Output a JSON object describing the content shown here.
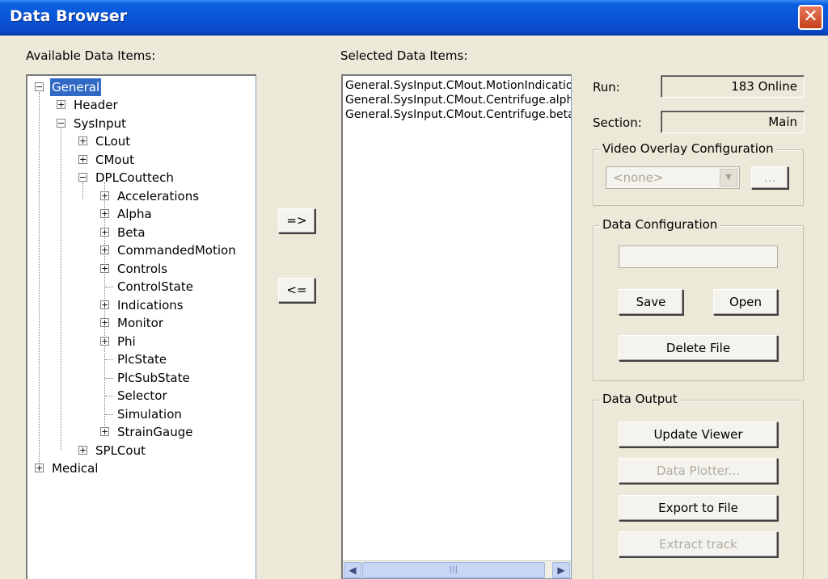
{
  "window": {
    "title": "Data Browser",
    "close_glyph": "✕"
  },
  "labels": {
    "available": "Available Data Items:",
    "selected": "Selected Data Items:",
    "run": "Run:",
    "section": "Section:"
  },
  "tree": {
    "items": [
      "General",
      "Header",
      "SysInput",
      "CLout",
      "CMout",
      "DPLCouttech",
      "Accelerations",
      "Alpha",
      "Beta",
      "CommandedMotion",
      "Controls",
      "ControlState",
      "Indications",
      "Monitor",
      "Phi",
      "PlcState",
      "PlcSubState",
      "Selector",
      "Simulation",
      "StrainGauge",
      "SPLCout",
      "Medical"
    ]
  },
  "buttons": {
    "add": "=>",
    "remove": "<=",
    "video_browse": "...",
    "save": "Save",
    "open": "Open",
    "delete_file": "Delete File",
    "update_viewer": "Update Viewer",
    "data_plotter": "Data Plotter...",
    "export_to_file": "Export to File",
    "extract_track": "Extract track"
  },
  "selected_items": [
    "General.SysInput.CMout.MotionIndicatio",
    "General.SysInput.CMout.Centrifuge.alph",
    "General.SysInput.CMout.Centrifuge.beta"
  ],
  "fields": {
    "run_value": "183 Online",
    "section_value": "Main"
  },
  "groups": {
    "video_overlay": "Video Overlay Configuration",
    "data_config": "Data Configuration",
    "data_output": "Data Output"
  },
  "video_combo": {
    "value": "<none>",
    "arrow_icon": "chevron-down-icon"
  },
  "scrollbar": {
    "left": "◀",
    "right": "▶",
    "grip": "|||"
  }
}
